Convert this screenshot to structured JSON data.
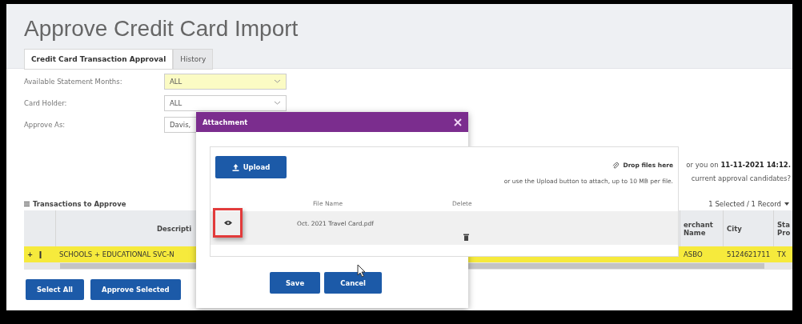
{
  "page": {
    "title": "Approve Credit Card Import"
  },
  "tabs": [
    {
      "label": "Credit Card Transaction Approval",
      "selected": true
    },
    {
      "label": "History",
      "selected": false
    }
  ],
  "filters": [
    {
      "label": "Available Statement Months:",
      "value": "ALL",
      "highlighted": true
    },
    {
      "label": "Card Holder:",
      "value": "ALL",
      "highlighted": false
    },
    {
      "label": "Approve As:",
      "value": "Davis,",
      "highlighted": false
    }
  ],
  "notice": {
    "line_1": "or you on **11-11-2021 14:12.**",
    "line_2": "current approval candidates?"
  },
  "grid": {
    "title": "Transactions to Approve",
    "record_count": "1 Selected / 1 Record",
    "columns": [
      {
        "line_1": "Descripti"
      },
      {
        "line_1": "erchant",
        "line_2": "Name"
      },
      {
        "line_1": "City"
      },
      {
        "line_1": "Sta",
        "line_2": "Pro"
      }
    ],
    "rows": [
      {
        "selected": true,
        "expander": "+",
        "cells": [
          "SCHOOLS + EDUCATIONAL SVC-N",
          "ASBO",
          "5124621711",
          "TX"
        ]
      }
    ]
  },
  "actions": [
    "Select All",
    "Approve Selected"
  ],
  "dialog": {
    "title": "Attachment",
    "upload_button": "Upload",
    "drop_hint": "Drop files here",
    "drop_subhint": "or use the Upload button to attach, up to 10 MB per file.",
    "columns": [
      "File Name",
      "Delete"
    ],
    "files": [
      {
        "name": "Oct. 2021 Travel Card.pdf",
        "highlighted": true
      }
    ],
    "buttons": [
      "Save",
      "Cancel"
    ]
  }
}
